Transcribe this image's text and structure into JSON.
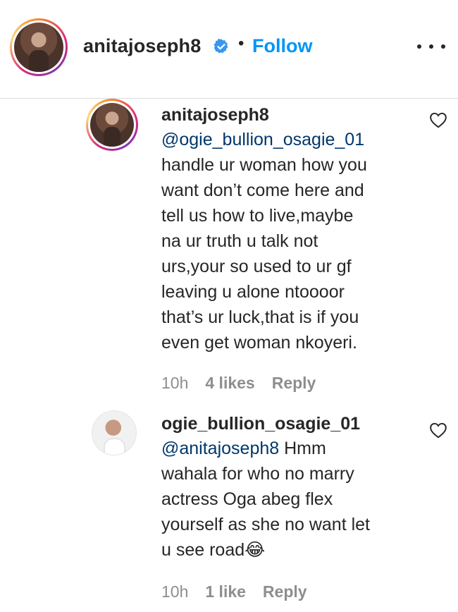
{
  "header": {
    "username": "anitajoseph8",
    "separator": "•",
    "follow_label": "Follow",
    "icons": {
      "verified": "verified-badge-icon",
      "more": "more-options-icon"
    },
    "colors": {
      "follow": "#0095f6",
      "verified": "#3897f0"
    }
  },
  "comments": [
    {
      "author": "anitajoseph8",
      "mention": "@ogie_bullion_osagie_01",
      "text": "handle ur woman how you\nwant don’t come here and\ntell us how to live,maybe\nna ur truth u talk not\nurs,your so used to ur gf\nleaving u alone ntoooor\nthat’s ur luck,that is if you\neven get woman nkoyeri.",
      "time": "10h",
      "likes": "4 likes",
      "reply": "Reply"
    },
    {
      "author": "ogie_bullion_osagie_01",
      "mention": "@anitajoseph8",
      "text_first": " Hmm",
      "text": "wahala for who no marry\nactress Oga abeg flex\nyourself as she no want let\nu see road",
      "emoji": "😂",
      "time": "10h",
      "likes": "1 like",
      "reply": "Reply"
    }
  ]
}
